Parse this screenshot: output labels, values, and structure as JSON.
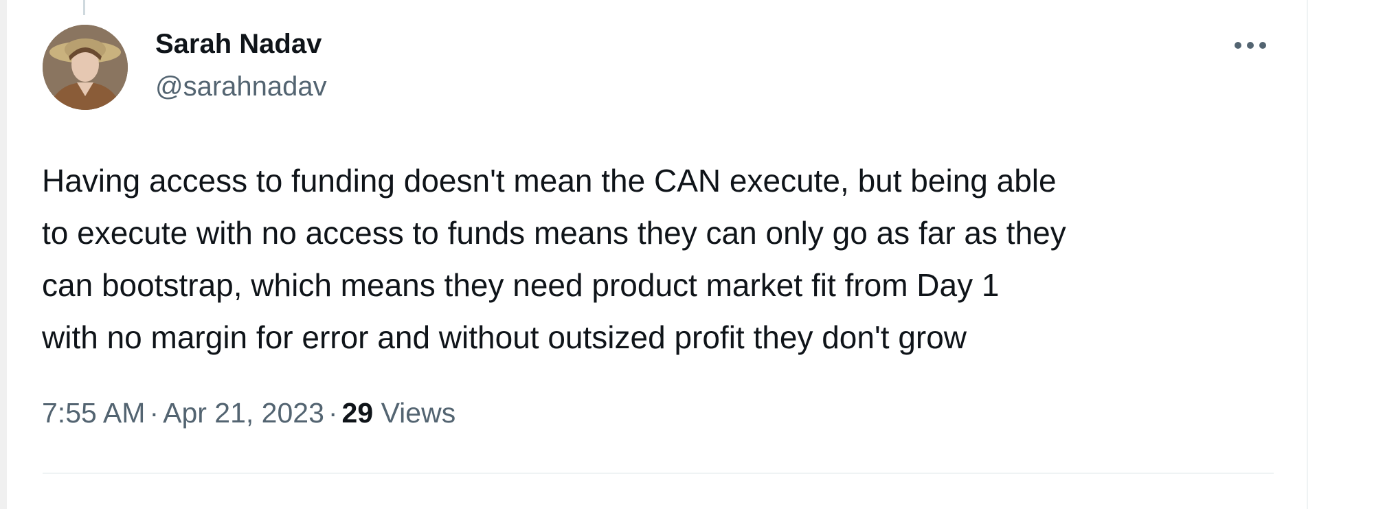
{
  "tweet": {
    "author": {
      "display_name": "Sarah Nadav",
      "handle": "@sarahnadav",
      "avatar_icon": "user-avatar-photo"
    },
    "more_icon": "more-horizontal-icon",
    "text_lines": [
      "Having access to funding doesn't mean the CAN execute, but being able",
      "to execute with no access to funds means they can only go as far as they",
      "can bootstrap, which means they need product market fit from Day 1",
      "with no margin for error and without outsized profit they don't grow"
    ],
    "time": "7:55 AM",
    "date": "Apr 21, 2023",
    "separator": "·",
    "views_count": "29",
    "views_label": "Views"
  },
  "colors": {
    "primary_text": "#0f1419",
    "secondary_text": "#536471",
    "border": "#eff3f4"
  }
}
